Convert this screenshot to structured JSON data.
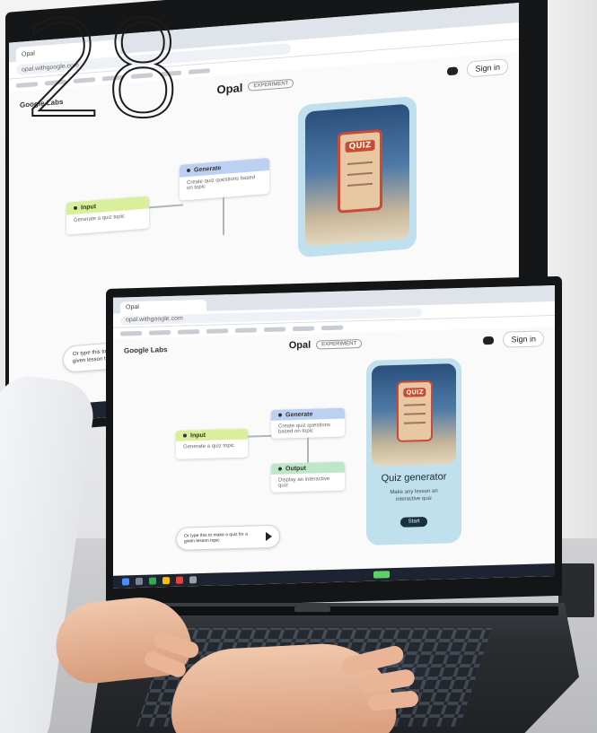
{
  "page_number": "28",
  "browser": {
    "tab_title": "Opal",
    "url": "opal.withgoogle.com"
  },
  "app": {
    "brand": "Google Labs",
    "title": "Opal",
    "badge": "EXPERIMENT",
    "signin_label": "Sign in"
  },
  "flow": {
    "input_node": {
      "title": "Input",
      "body": "Generate a quiz topic"
    },
    "generate_node": {
      "title": "Generate",
      "body": "Create quiz questions based on topic"
    },
    "output_node": {
      "title": "Output",
      "body": "Display an interactive quiz"
    }
  },
  "preview": {
    "image_label": "QUIZ",
    "title": "Quiz generator",
    "description": "Make any lesson an interactive quiz",
    "start_button": "Start"
  },
  "prompt": {
    "text": "Or type this to make a quiz for a given lesson topic"
  },
  "colors": {
    "input_head": "#d9ef9c",
    "generate_head": "#bcd0f2",
    "output_head": "#bfe6c8",
    "preview_bg": "#bfe0ec",
    "quiz_red": "#c94a35",
    "taskbar": "#1d2330"
  }
}
